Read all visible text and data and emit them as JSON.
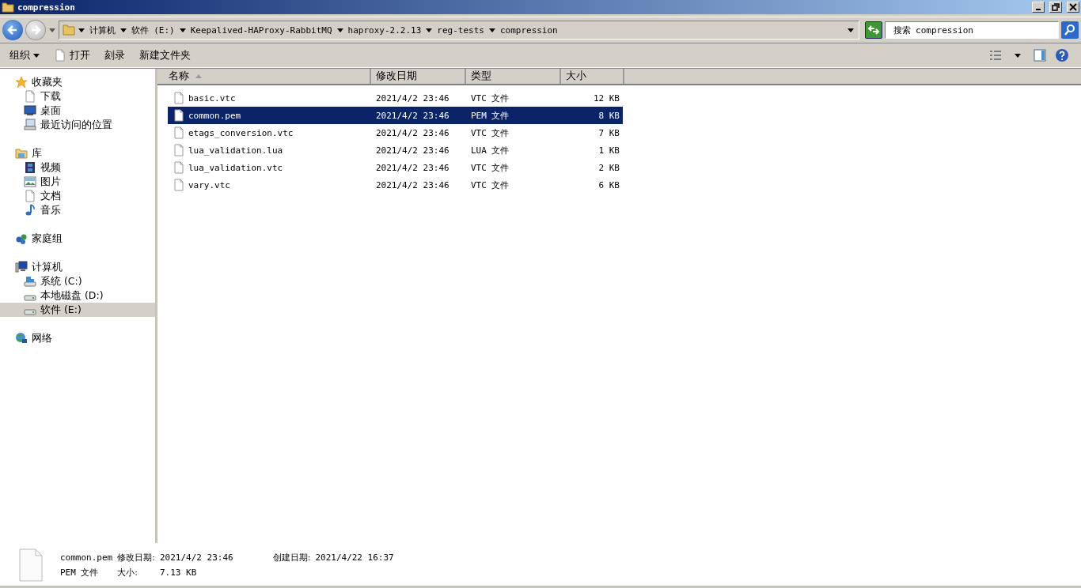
{
  "window": {
    "title": "compression"
  },
  "address": {
    "crumbs": [
      "计算机",
      "软件 (E:)",
      "Keepalived-HAProxy-RabbitMQ",
      "haproxy-2.2.13",
      "reg-tests",
      "compression"
    ]
  },
  "search": {
    "placeholder": "搜索 compression"
  },
  "toolbar": {
    "buttons": [
      {
        "label": "组织",
        "dropdown": true
      },
      {
        "label": "打开",
        "dropdown": false
      },
      {
        "label": "刻录",
        "dropdown": false
      },
      {
        "label": "新建文件夹",
        "dropdown": false
      }
    ]
  },
  "sidebar": {
    "items": [
      {
        "label": "收藏夹",
        "selected": false,
        "children": [
          {
            "label": "下载",
            "selected": false
          },
          {
            "label": "桌面",
            "selected": false
          },
          {
            "label": "最近访问的位置",
            "selected": false
          }
        ]
      },
      {
        "label": "库",
        "selected": false,
        "children": [
          {
            "label": "视频",
            "selected": false
          },
          {
            "label": "图片",
            "selected": false
          },
          {
            "label": "文档",
            "selected": false
          },
          {
            "label": "音乐",
            "selected": false
          }
        ]
      },
      {
        "label": "家庭组",
        "selected": false
      },
      {
        "label": "计算机",
        "selected": false,
        "children": [
          {
            "label": "系统 (C:)",
            "selected": false
          },
          {
            "label": "本地磁盘 (D:)",
            "selected": false
          },
          {
            "label": "软件 (E:)",
            "selected": true
          }
        ]
      },
      {
        "label": "网络",
        "selected": false
      }
    ]
  },
  "table": {
    "columns": [
      {
        "label": "名称",
        "sorted": true
      },
      {
        "label": "修改日期",
        "sorted": false
      },
      {
        "label": "类型",
        "sorted": false
      },
      {
        "label": "大小",
        "sorted": false
      }
    ],
    "rows": [
      {
        "name": "basic.vtc",
        "modified": "2021/4/2 23:46",
        "type": "VTC 文件",
        "size": "12 KB",
        "selected": false
      },
      {
        "name": "common.pem",
        "modified": "2021/4/2 23:46",
        "type": "PEM 文件",
        "size": "8 KB",
        "selected": true
      },
      {
        "name": "etags_conversion.vtc",
        "modified": "2021/4/2 23:46",
        "type": "VTC 文件",
        "size": "7 KB",
        "selected": false
      },
      {
        "name": "lua_validation.lua",
        "modified": "2021/4/2 23:46",
        "type": "LUA 文件",
        "size": "1 KB",
        "selected": false
      },
      {
        "name": "lua_validation.vtc",
        "modified": "2021/4/2 23:46",
        "type": "VTC 文件",
        "size": "2 KB",
        "selected": false
      },
      {
        "name": "vary.vtc",
        "modified": "2021/4/2 23:46",
        "type": "VTC 文件",
        "size": "6 KB",
        "selected": false
      }
    ]
  },
  "details": {
    "name": "common.pem",
    "modified_label": "修改日期:",
    "modified": "2021/4/2 23:46",
    "created_label": "创建日期:",
    "created": "2021/4/22 16:37",
    "type": "PEM 文件",
    "size_label": "大小:",
    "size": "7.13 KB"
  }
}
